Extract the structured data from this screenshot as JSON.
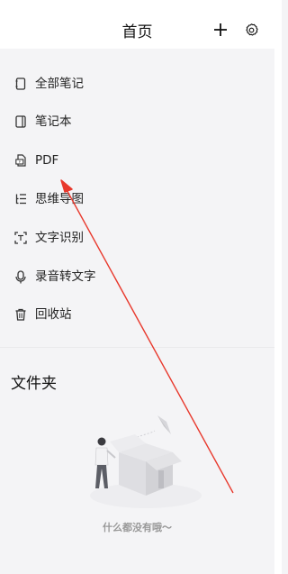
{
  "header": {
    "title": "首页",
    "add_icon": "plus-icon",
    "settings_icon": "gear-icon"
  },
  "menu": {
    "items": [
      {
        "label": "全部笔记",
        "icon": "all-notes-icon"
      },
      {
        "label": "笔记本",
        "icon": "notebook-icon"
      },
      {
        "label": "PDF",
        "icon": "pdf-icon"
      },
      {
        "label": "思维导图",
        "icon": "mind-map-icon"
      },
      {
        "label": "文字识别",
        "icon": "scan-text-icon"
      },
      {
        "label": "录音转文字",
        "icon": "microphone-icon"
      },
      {
        "label": "回收站",
        "icon": "trash-icon"
      }
    ]
  },
  "folders": {
    "title": "文件夹",
    "empty_text": "什么都没有哦～"
  },
  "colors": {
    "background": "#f4f4f6",
    "surface": "#ffffff",
    "annotation_arrow": "#e8382c"
  }
}
